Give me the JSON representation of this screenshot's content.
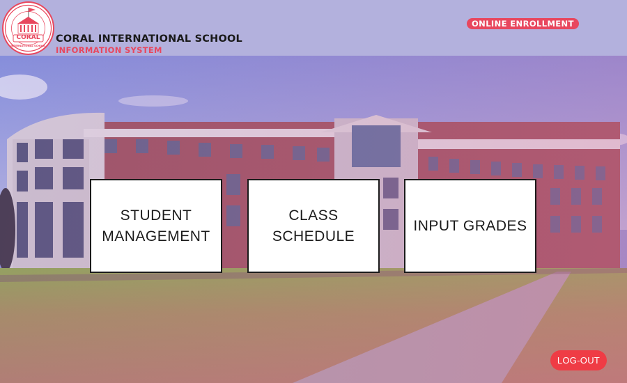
{
  "header": {
    "school_name": "CORAL INTERNATIONAL SCHOOL",
    "system_name": "INFORMATION SYSTEM",
    "enrollment_badge": "ONLINE ENROLLMENT",
    "logo": {
      "text": "CORAL",
      "ring_text": "INTERNATIONAL SCHOOL"
    }
  },
  "menu": {
    "cards": [
      {
        "line1": "STUDENT",
        "line2": "MANAGEMENT"
      },
      {
        "line1": "CLASS",
        "line2": "SCHEDULE"
      },
      {
        "line1": "INPUT GRADES",
        "line2": ""
      }
    ]
  },
  "actions": {
    "logout_label": "LOG-OUT"
  },
  "colors": {
    "accent": "#e8475e",
    "logout": "#ef3c45",
    "header_bg": "#b3b1dd"
  }
}
